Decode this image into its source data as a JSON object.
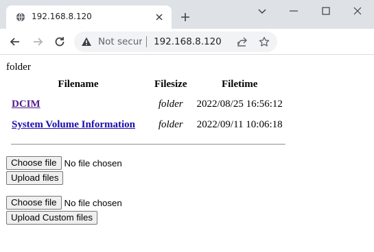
{
  "browser": {
    "tab_title": "192.168.8.120",
    "security_label": "Not secure",
    "url": "192.168.8.120"
  },
  "page": {
    "folder_title": "folder",
    "table": {
      "headers": [
        "Filename",
        "Filesize",
        "Filetime"
      ],
      "rows": [
        {
          "name": "DCIM",
          "size": "folder",
          "time": "2022/08/25 16:56:12"
        },
        {
          "name": "System Volume Information",
          "size": "folder",
          "time": "2022/09/11 10:06:18"
        }
      ]
    },
    "upload_form": {
      "choose_label": "Choose file",
      "no_file_label": "No file chosen",
      "submit_label": "Upload files"
    },
    "custom_upload_form": {
      "choose_label": "Choose file",
      "no_file_label": "No file chosen",
      "submit_label": "Upload Custom files"
    }
  },
  "icons": {
    "tab_favicon": "globe-icon",
    "tab_close": "close-icon",
    "new_tab": "plus-icon",
    "minimize": "minimize-icon",
    "maximize": "maximize-icon",
    "close_window": "close-icon",
    "back": "back-arrow-icon",
    "forward": "forward-arrow-icon",
    "reload": "reload-icon",
    "warning": "warning-icon",
    "share": "share-icon",
    "bookmark": "star-icon"
  },
  "colors": {
    "titlebar_bg": "#dee1e6",
    "omnibox_bg": "#f1f3f4",
    "link": "#1a0dab",
    "visited_link": "#551a8b"
  }
}
